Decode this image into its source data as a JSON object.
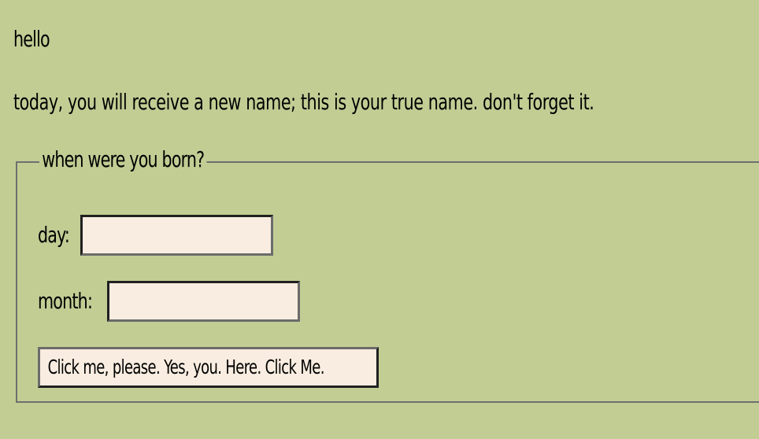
{
  "page": {
    "greeting": "hello",
    "intro": "today, you will receive a new name; this is your true name. don't forget it."
  },
  "birth_form": {
    "legend": "when were you born?",
    "day": {
      "label": "day:",
      "value": "",
      "placeholder": ""
    },
    "month": {
      "label": "month:",
      "value": "",
      "placeholder": ""
    },
    "submit_label": "Click me, please. Yes, you. Here. Click Me."
  },
  "colors": {
    "background": "#c2cd94",
    "input_background": "#f8ede0",
    "border_dark": "#202020",
    "border_light": "#6b6b6b"
  }
}
